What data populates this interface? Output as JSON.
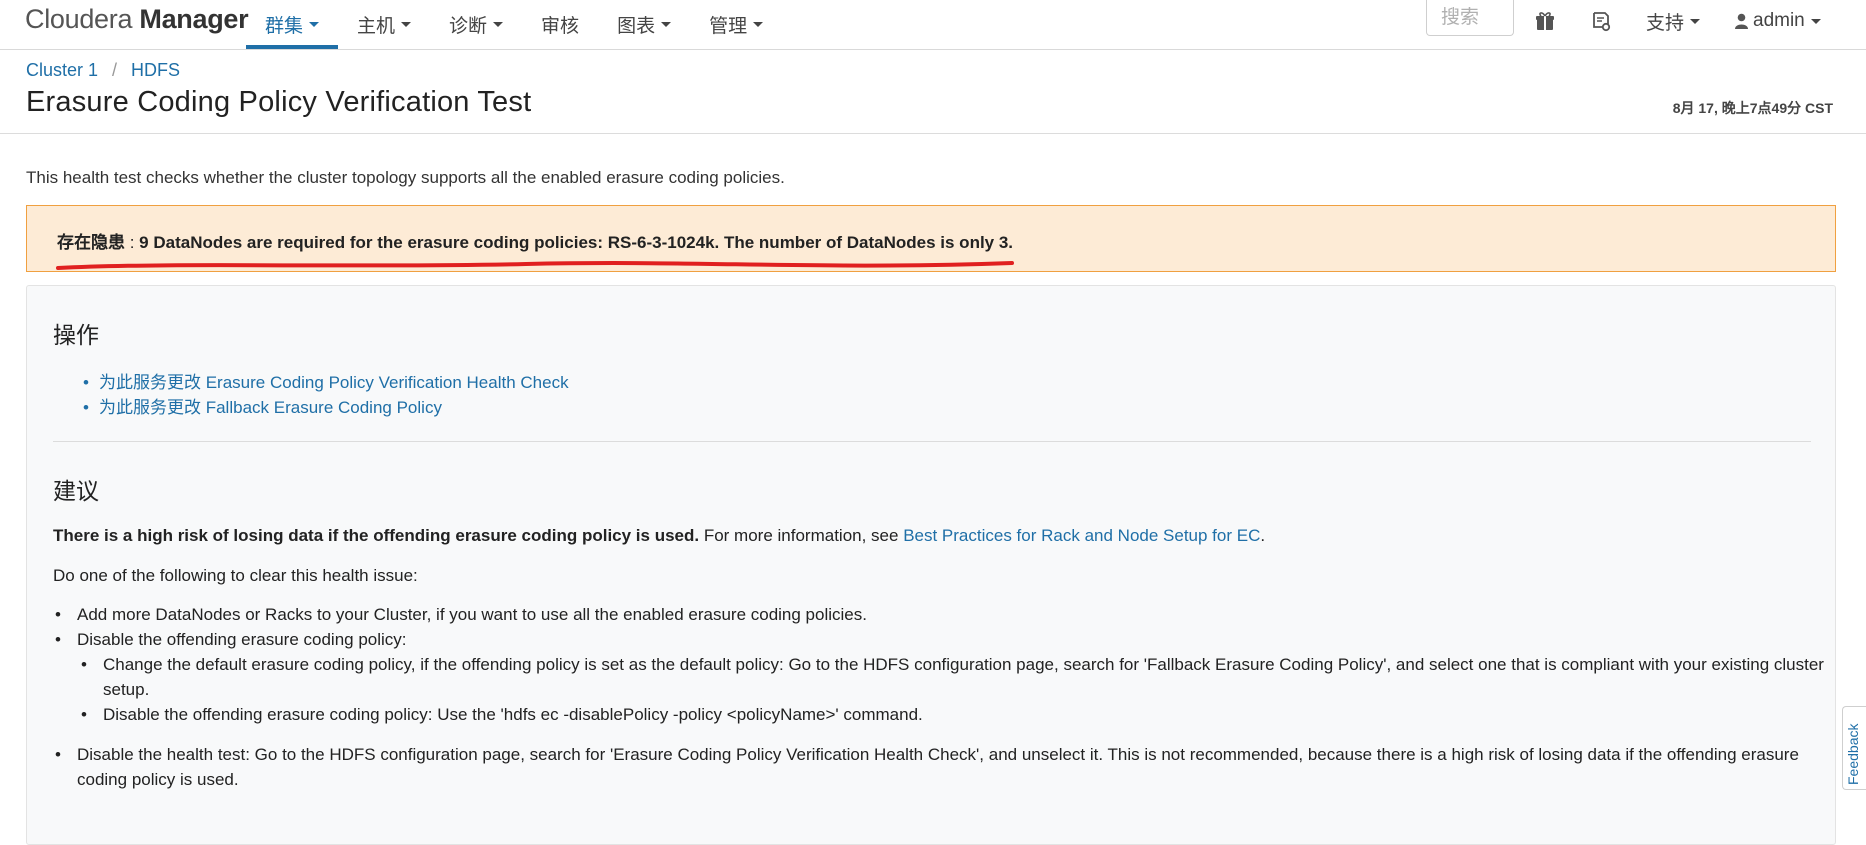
{
  "brand": {
    "prefix": "Cloudera",
    "name": "Manager"
  },
  "nav": {
    "items": [
      {
        "label": "群集",
        "dropdown": true,
        "active": true
      },
      {
        "label": "主机",
        "dropdown": true
      },
      {
        "label": "诊断",
        "dropdown": true
      },
      {
        "label": "审核",
        "dropdown": false
      },
      {
        "label": "图表",
        "dropdown": true
      },
      {
        "label": "管理",
        "dropdown": true
      }
    ],
    "search_placeholder": "搜索",
    "support_label": "支持",
    "user_label": "admin",
    "icons": [
      "gift-icon",
      "parcel-icon",
      "user-icon"
    ]
  },
  "breadcrumb": {
    "items": [
      "Cluster 1",
      "HDFS"
    ],
    "separator": "/"
  },
  "page": {
    "title": "Erasure Coding Policy Verification Test",
    "timestamp": "8月 17, 晚上7点49分 CST",
    "intro": "This health test checks whether the cluster topology supports all the enabled erasure coding policies."
  },
  "alert": {
    "label": "存在隐患",
    "separator": " : ",
    "message": "9 DataNodes are required for the erasure coding policies: RS-6-3-1024k. The number of DataNodes is only 3."
  },
  "actions": {
    "title": "操作",
    "links": [
      "为此服务更改 Erasure Coding Policy Verification Health Check",
      "为此服务更改 Fallback Erasure Coding Policy"
    ]
  },
  "advice": {
    "title": "建议",
    "risk_bold": "There is a high risk of losing data if the offending erasure coding policy is used.",
    "risk_more": " For more information, see ",
    "risk_link": "Best Practices for Rack and Node Setup for EC",
    "risk_end": ".",
    "do_one": "Do one of the following to clear this health issue:",
    "item1": "Add more DataNodes or Racks to your Cluster, if you want to use all the enabled erasure coding policies.",
    "item2": "Disable the offending erasure coding policy:",
    "sub1": "Change the default erasure coding policy, if the offending policy is set as the default policy: Go to the HDFS configuration page, search for 'Fallback Erasure Coding Policy', and select one that is compliant with your existing cluster setup.",
    "sub2": "Disable the offending erasure coding policy: Use the 'hdfs ec -disablePolicy -policy <policyName>' command.",
    "item3": "Disable the health test: Go to the HDFS configuration page, search for 'Erasure Coding Policy Verification Health Check', and unselect it. This is not recommended, because there is a high risk of losing data if the offending erasure coding policy is used."
  },
  "feedback": "Feedback",
  "colors": {
    "link": "#1f6fa7",
    "alert_bg": "#fdebd6",
    "alert_border": "#f0a040",
    "annotation": "#e02020"
  }
}
